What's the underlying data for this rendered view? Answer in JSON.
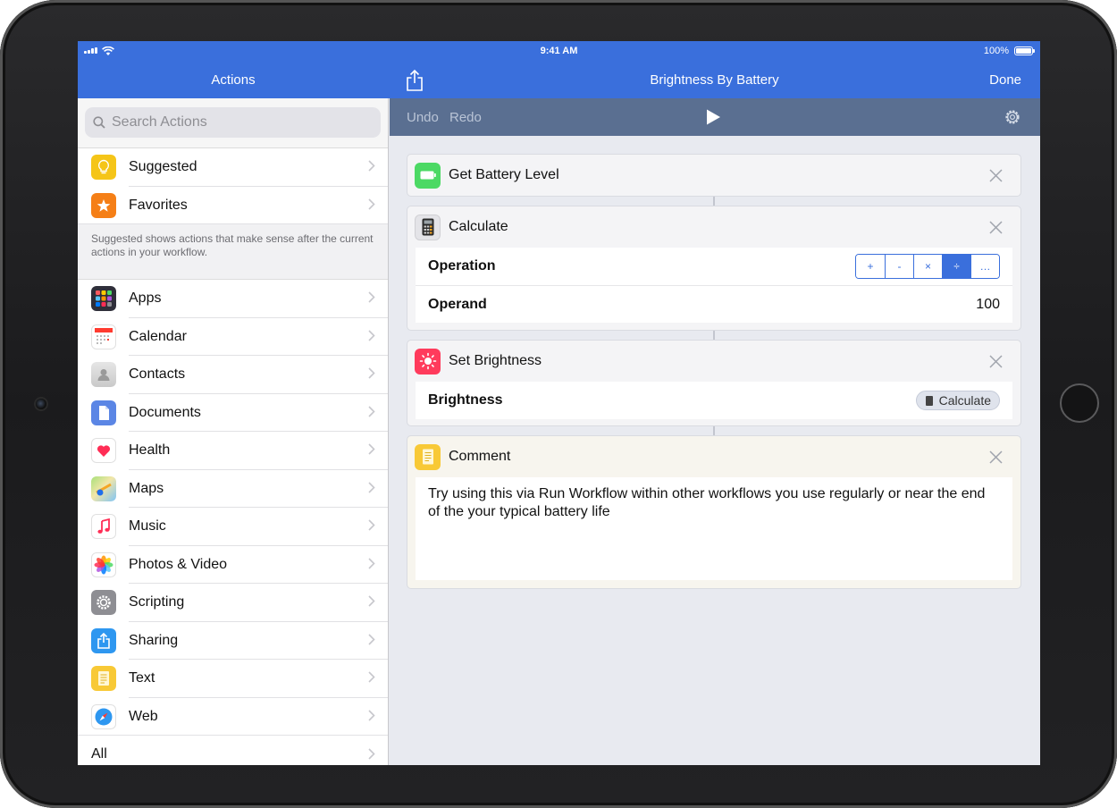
{
  "status": {
    "time": "9:41 AM",
    "battery": "100%"
  },
  "nav": {
    "left_title": "Actions",
    "title": "Brightness By Battery",
    "done": "Done"
  },
  "search": {
    "placeholder": "Search Actions"
  },
  "sidebar": {
    "top_items": [
      {
        "label": "Suggested",
        "icon": "lightbulb-icon",
        "color": "#f5c518"
      },
      {
        "label": "Favorites",
        "icon": "star-icon",
        "color": "#f57f17"
      }
    ],
    "hint": "Suggested shows actions that make sense after the current actions in your workflow.",
    "categories": [
      {
        "label": "Apps",
        "icon": "apps-grid-icon"
      },
      {
        "label": "Calendar",
        "icon": "calendar-icon"
      },
      {
        "label": "Contacts",
        "icon": "contacts-icon"
      },
      {
        "label": "Documents",
        "icon": "documents-icon"
      },
      {
        "label": "Health",
        "icon": "heart-icon"
      },
      {
        "label": "Maps",
        "icon": "maps-icon"
      },
      {
        "label": "Music",
        "icon": "music-note-icon"
      },
      {
        "label": "Photos & Video",
        "icon": "photos-icon"
      },
      {
        "label": "Scripting",
        "icon": "scripting-gear-icon"
      },
      {
        "label": "Sharing",
        "icon": "share-icon"
      },
      {
        "label": "Text",
        "icon": "text-notepad-icon"
      },
      {
        "label": "Web",
        "icon": "safari-compass-icon"
      }
    ],
    "all": "All"
  },
  "toolbar": {
    "undo": "Undo",
    "redo": "Redo"
  },
  "workflow": {
    "actions": [
      {
        "title": "Get Battery Level",
        "icon": "battery-icon",
        "color": "#4cd964"
      },
      {
        "title": "Calculate",
        "icon": "calculator-icon",
        "params": [
          {
            "name": "Operation",
            "options": [
              "+",
              "-",
              "×",
              "÷",
              "…"
            ],
            "selected": "÷"
          },
          {
            "name": "Operand",
            "value": "100"
          }
        ]
      },
      {
        "title": "Set Brightness",
        "icon": "brightness-sun-icon",
        "color": "#ff3b5c",
        "params": [
          {
            "name": "Brightness",
            "token": "Calculate"
          }
        ]
      },
      {
        "title": "Comment",
        "icon": "comment-notepad-icon",
        "color": "#f8c936",
        "text": "Try using this via Run Workflow within other workflows you use regularly or near the end of the your typical battery life"
      }
    ]
  },
  "colors": {
    "accent": "#3a6fdc",
    "toolbar": "#5a6f91"
  }
}
